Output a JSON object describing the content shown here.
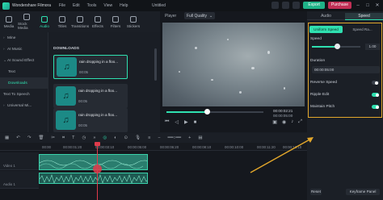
{
  "titlebar": {
    "app_name": "Wondershare Filmora",
    "menu": [
      "File",
      "Edit",
      "Tools",
      "View",
      "Help"
    ],
    "project": "Untitled",
    "purchase_label": "Purchase",
    "export_label": "Export"
  },
  "toolbar": {
    "items": [
      {
        "label": "Media",
        "icon": "media-icon"
      },
      {
        "label": "Stock Media",
        "icon": "stock-media-icon"
      },
      {
        "label": "Audio",
        "icon": "audio-icon",
        "active": true
      },
      {
        "label": "Titles",
        "icon": "titles-icon"
      },
      {
        "label": "Transitions",
        "icon": "transitions-icon"
      },
      {
        "label": "Effects",
        "icon": "effects-icon"
      },
      {
        "label": "Filters",
        "icon": "filters-icon"
      },
      {
        "label": "Stickers",
        "icon": "stickers-icon"
      }
    ]
  },
  "leftnav": {
    "items": [
      {
        "label": "Mine",
        "arrow": "›"
      },
      {
        "label": "AI Music",
        "arrow": "›"
      },
      {
        "label": "AI Sound Effect",
        "arrow": "⌄"
      },
      {
        "label": "Text",
        "arrow": ""
      },
      {
        "label": "Downloads",
        "arrow": "",
        "selected": true
      },
      {
        "label": "Text To Speech",
        "arrow": ""
      },
      {
        "label": "Universal Mi...",
        "arrow": "›"
      }
    ]
  },
  "media": {
    "section_title": "DOWNLOADS",
    "items": [
      {
        "title": "rain dropping in a floo...",
        "duration": "00:05",
        "selected": true
      },
      {
        "title": "rain dropping in a floo...",
        "duration": "00:05",
        "selected": false
      },
      {
        "title": "rain dropping in a floo...",
        "duration": "00:05",
        "selected": false
      }
    ]
  },
  "player": {
    "label": "Player",
    "quality": "Full Quality",
    "time_current": "00:00:02:21",
    "time_total": "00:00:05:00",
    "progress": 0.42
  },
  "rightpanel": {
    "tabs": [
      "Audio",
      "Speed"
    ],
    "speed_tabs": [
      "Uniform Speed",
      "Speed Ra..."
    ],
    "speed_label": "Speed",
    "speed_value": "1.00",
    "speed_position": 0.52,
    "duration_label": "Duration",
    "duration_value": "00:00:05:00",
    "toggles": [
      {
        "label": "Reverse Speed",
        "on": false
      },
      {
        "label": "Ripple Edit",
        "on": true
      },
      {
        "label": "Maintain Pitch",
        "on": true
      }
    ],
    "reset_label": "Reset",
    "keyframe_label": "Keyframe Panel"
  },
  "timeline": {
    "ruler": [
      "00:00",
      "00:00:01:20",
      "00:00:03:10",
      "00:00:05:00",
      "00:00:06:20",
      "00:00:08:10",
      "00:00:10:00",
      "00:00:11:20",
      "00:00:13:10"
    ],
    "tracks": [
      {
        "name": "Video 1"
      },
      {
        "name": "Audio 1"
      }
    ]
  }
}
